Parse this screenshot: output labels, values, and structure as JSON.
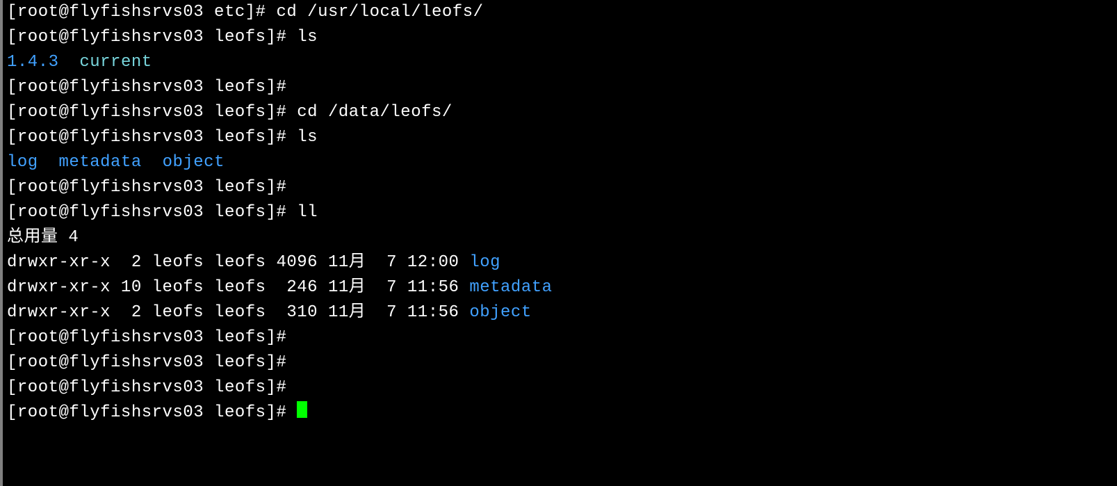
{
  "lines": [
    {
      "segments": [
        {
          "text": "[root@flyfishsrvs03 etc]# cd /usr/local/leofs/",
          "cls": "white"
        }
      ]
    },
    {
      "segments": [
        {
          "text": "[root@flyfishsrvs03 leofs]# ls",
          "cls": "white"
        }
      ]
    },
    {
      "segments": [
        {
          "text": "1.4.3",
          "cls": "blue"
        },
        {
          "text": "  ",
          "cls": "white"
        },
        {
          "text": "current",
          "cls": "cyan"
        }
      ]
    },
    {
      "segments": [
        {
          "text": "[root@flyfishsrvs03 leofs]# ",
          "cls": "white"
        }
      ]
    },
    {
      "segments": [
        {
          "text": "[root@flyfishsrvs03 leofs]# cd /data/leofs/",
          "cls": "white"
        }
      ]
    },
    {
      "segments": [
        {
          "text": "[root@flyfishsrvs03 leofs]# ls",
          "cls": "white"
        }
      ]
    },
    {
      "segments": [
        {
          "text": "log",
          "cls": "blue"
        },
        {
          "text": "  ",
          "cls": "white"
        },
        {
          "text": "metadata",
          "cls": "blue"
        },
        {
          "text": "  ",
          "cls": "white"
        },
        {
          "text": "object",
          "cls": "blue"
        }
      ]
    },
    {
      "segments": [
        {
          "text": "[root@flyfishsrvs03 leofs]# ",
          "cls": "white"
        }
      ]
    },
    {
      "segments": [
        {
          "text": "[root@flyfishsrvs03 leofs]# ll",
          "cls": "white"
        }
      ]
    },
    {
      "segments": [
        {
          "text": "总用量 4",
          "cls": "white"
        }
      ]
    },
    {
      "segments": [
        {
          "text": "drwxr-xr-x  2 leofs leofs 4096 11月  7 12:00 ",
          "cls": "white"
        },
        {
          "text": "log",
          "cls": "blue"
        }
      ]
    },
    {
      "segments": [
        {
          "text": "drwxr-xr-x 10 leofs leofs  246 11月  7 11:56 ",
          "cls": "white"
        },
        {
          "text": "metadata",
          "cls": "blue"
        }
      ]
    },
    {
      "segments": [
        {
          "text": "drwxr-xr-x  2 leofs leofs  310 11月  7 11:56 ",
          "cls": "white"
        },
        {
          "text": "object",
          "cls": "blue"
        }
      ]
    },
    {
      "segments": [
        {
          "text": "[root@flyfishsrvs03 leofs]# ",
          "cls": "white"
        }
      ]
    },
    {
      "segments": [
        {
          "text": "[root@flyfishsrvs03 leofs]# ",
          "cls": "white"
        }
      ]
    },
    {
      "segments": [
        {
          "text": "[root@flyfishsrvs03 leofs]# ",
          "cls": "white"
        }
      ]
    },
    {
      "segments": [
        {
          "text": "[root@flyfishsrvs03 leofs]# ",
          "cls": "white"
        }
      ],
      "cursor": true
    }
  ]
}
